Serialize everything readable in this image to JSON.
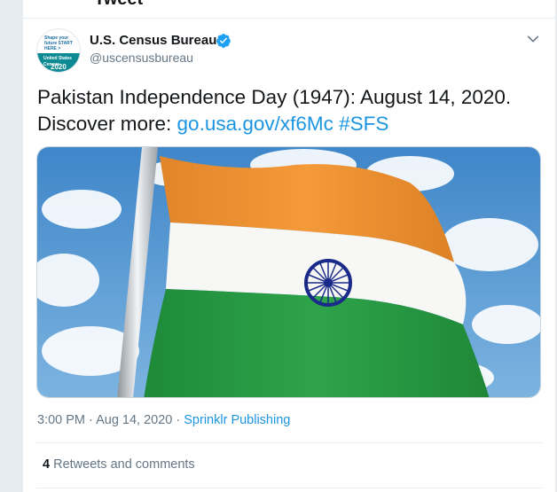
{
  "header": {
    "title": "Tweet"
  },
  "author": {
    "name": "U.S. Census Bureau",
    "handle": "@uscensusbureau",
    "verified": true,
    "avatar_text_top": "Shape your future START HERE >",
    "avatar_text_main": "United States Census",
    "avatar_text_year": "2020"
  },
  "tweet": {
    "line1": "Pakistan Independence Day (1947): August 14, 2020.",
    "line2_prefix": "Discover more: ",
    "link": "go.usa.gov/xf6Mc",
    "hashtag": "#SFS"
  },
  "media": {
    "description_icon": "flag-photo"
  },
  "meta": {
    "time": "3:00 PM",
    "separator1": " · ",
    "date": "Aug 14, 2020",
    "separator2": " · ",
    "source": "Sprinklr Publishing"
  },
  "stats": {
    "retweets_count": "4",
    "retweets_label": " Retweets and comments"
  },
  "colors": {
    "link": "#1b95e0",
    "verified": "#1da1f2",
    "secondary": "#657786"
  }
}
